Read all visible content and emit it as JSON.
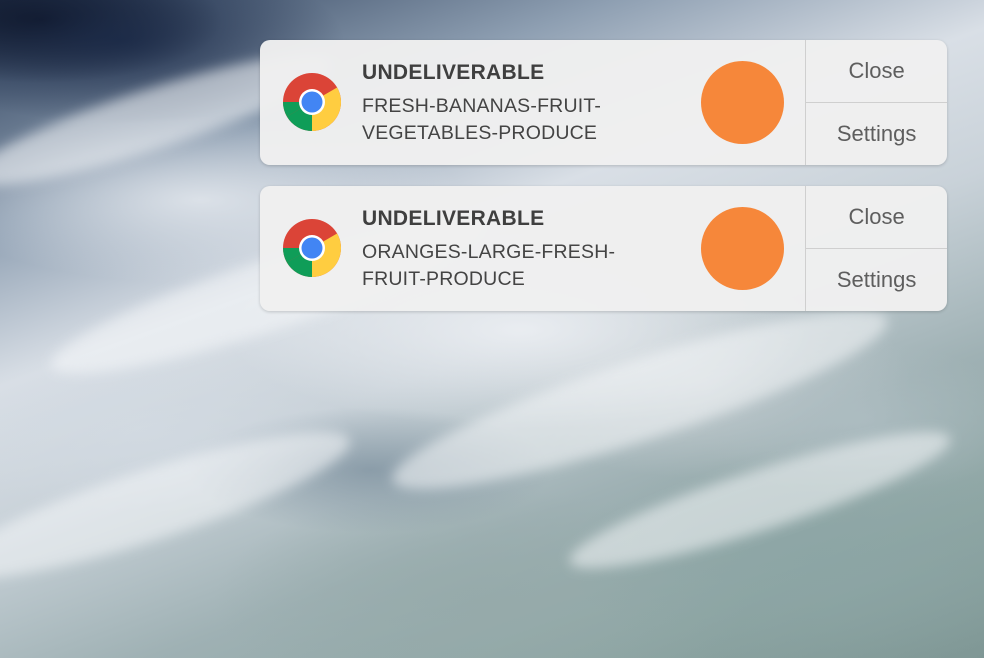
{
  "colors": {
    "notification_bg": "#f0f0f0",
    "image_accent": "#f6873a",
    "title_text": "#3f3f3f",
    "body_text": "#444444",
    "button_text": "#5e5e5e"
  },
  "notifications": [
    {
      "app_icon": "chrome-icon",
      "title": "UNDELIVERABLE",
      "body_line1": "FRESH-BANANAS-FRUIT-",
      "body_line2": "VEGETABLES-PRODUCE",
      "close_label": "Close",
      "settings_label": "Settings"
    },
    {
      "app_icon": "chrome-icon",
      "title": "UNDELIVERABLE",
      "body_line1": "ORANGES-LARGE-FRESH-",
      "body_line2": "FRUIT-PRODUCE",
      "close_label": "Close",
      "settings_label": "Settings"
    }
  ]
}
